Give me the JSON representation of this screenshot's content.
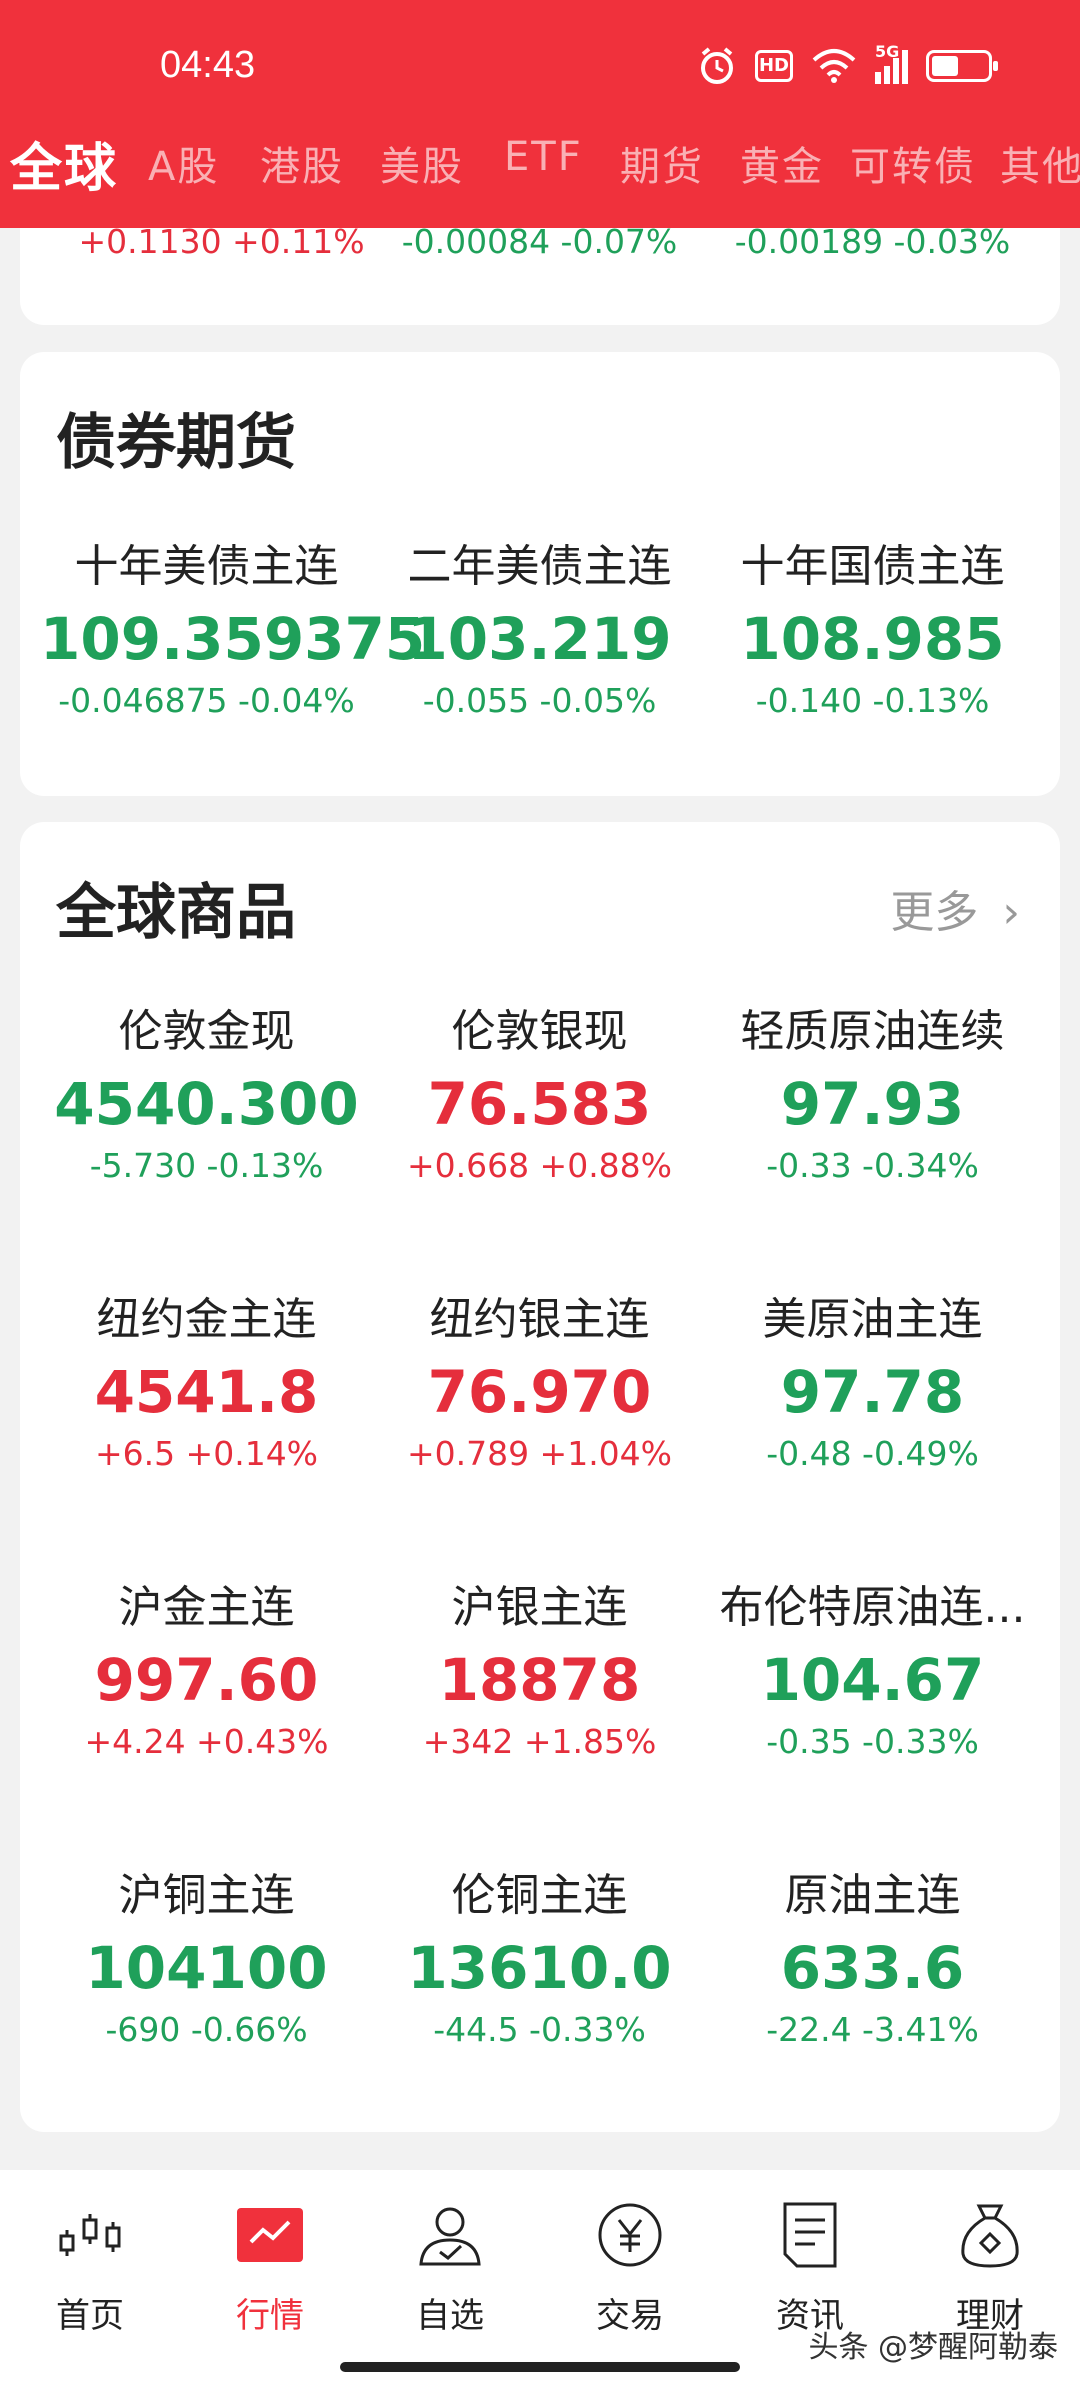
{
  "status_bar": {
    "time": "04:43",
    "network": "5G",
    "hd": "HD"
  },
  "tabs": [
    {
      "label": "全球"
    },
    {
      "label": "A股"
    },
    {
      "label": "港股"
    },
    {
      "label": "美股"
    },
    {
      "label": "ETF"
    },
    {
      "label": "期货"
    },
    {
      "label": "黄金"
    },
    {
      "label": "可转债"
    },
    {
      "label": "其他"
    }
  ],
  "partial_row": [
    {
      "change": "+0.1130 +0.11%",
      "dir": "up"
    },
    {
      "change": "-0.00084 -0.07%",
      "dir": "down"
    },
    {
      "change": "-0.00189 -0.03%",
      "dir": "down"
    }
  ],
  "bond_futures": {
    "title": "债券期货",
    "items": [
      {
        "name": "十年美债主连",
        "price": "109.359375",
        "change": "-0.046875 -0.04%",
        "dir": "down"
      },
      {
        "name": "二年美债主连",
        "price": "103.219",
        "change": "-0.055 -0.05%",
        "dir": "down"
      },
      {
        "name": "十年国债主连",
        "price": "108.985",
        "change": "-0.140 -0.13%",
        "dir": "down"
      }
    ]
  },
  "commodities": {
    "title": "全球商品",
    "more": "更多",
    "items": [
      {
        "name": "伦敦金现",
        "price": "4540.300",
        "change": "-5.730 -0.13%",
        "dir": "down"
      },
      {
        "name": "伦敦银现",
        "price": "76.583",
        "change": "+0.668 +0.88%",
        "dir": "up"
      },
      {
        "name": "轻质原油连续",
        "price": "97.93",
        "change": "-0.33 -0.34%",
        "dir": "down"
      },
      {
        "name": "纽约金主连",
        "price": "4541.8",
        "change": "+6.5 +0.14%",
        "dir": "up"
      },
      {
        "name": "纽约银主连",
        "price": "76.970",
        "change": "+0.789 +1.04%",
        "dir": "up"
      },
      {
        "name": "美原油主连",
        "price": "97.78",
        "change": "-0.48 -0.49%",
        "dir": "down"
      },
      {
        "name": "沪金主连",
        "price": "997.60",
        "change": "+4.24 +0.43%",
        "dir": "up"
      },
      {
        "name": "沪银主连",
        "price": "18878",
        "change": "+342 +1.85%",
        "dir": "up"
      },
      {
        "name": "布伦特原油连...",
        "price": "104.67",
        "change": "-0.35 -0.33%",
        "dir": "down"
      },
      {
        "name": "沪铜主连",
        "price": "104100",
        "change": "-690 -0.66%",
        "dir": "down"
      },
      {
        "name": "伦铜主连",
        "price": "13610.0",
        "change": "-44.5 -0.33%",
        "dir": "down"
      },
      {
        "name": "原油主连",
        "price": "633.6",
        "change": "-22.4 -3.41%",
        "dir": "down"
      }
    ]
  },
  "bottom_nav": [
    {
      "label": "首页",
      "icon": "candlestick-icon"
    },
    {
      "label": "行情",
      "icon": "trend-chart-icon",
      "active": true
    },
    {
      "label": "自选",
      "icon": "user-check-icon"
    },
    {
      "label": "交易",
      "icon": "yen-coin-icon"
    },
    {
      "label": "资讯",
      "icon": "document-icon"
    },
    {
      "label": "理财",
      "icon": "money-bag-icon"
    }
  ],
  "watermark": "头条 @梦醒阿勒泰",
  "colors": {
    "header": "#f0313c",
    "up": "#e52e3c",
    "down": "#1fa05a"
  }
}
